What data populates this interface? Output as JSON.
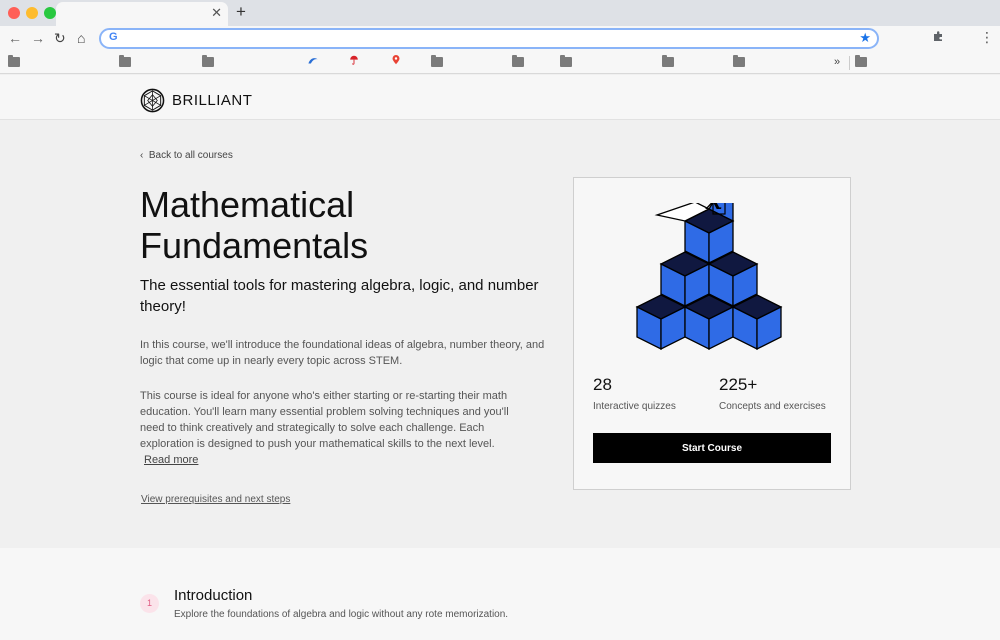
{
  "browser": {
    "address_value": "",
    "icons": [
      "back-arrow-icon",
      "forward-arrow-icon",
      "reload-icon",
      "home-icon",
      "star-icon",
      "puzzle-icon",
      "more-icon"
    ]
  },
  "site": {
    "logo_text": "BRILLIANT"
  },
  "course": {
    "back_link": "Back to all courses",
    "title": "Mathematical Fundamentals",
    "subtitle": "The essential tools for mastering algebra, logic, and number theory!",
    "paragraph1": "In this course, we'll introduce the foundational ideas of algebra, number theory, and logic that come up in nearly every topic across STEM.",
    "paragraph2": "This course is ideal for anyone who's either starting or re-starting their math education. You'll learn many essential problem solving techniques and you'll need to think creatively and strategically to solve each challenge. Each exploration is designed to push your mathematical skills to the next level.",
    "read_more": "Read more",
    "prerequisites_link": "View prerequisites and next steps"
  },
  "card": {
    "illustration_symbol": "x",
    "stats": [
      {
        "value": "28",
        "label": "Interactive quizzes"
      },
      {
        "value": "225+",
        "label": "Concepts and exercises"
      }
    ],
    "start_button": "Start Course"
  },
  "chapters": [
    {
      "number": "1",
      "title": "Introduction",
      "description": "Explore the foundations of algebra and logic without any rote memorization."
    }
  ],
  "colors": {
    "cube_blue": "#2f6be6",
    "chapter_badge_bg": "#fbe3ea",
    "chapter_badge_text": "#e05d84"
  }
}
